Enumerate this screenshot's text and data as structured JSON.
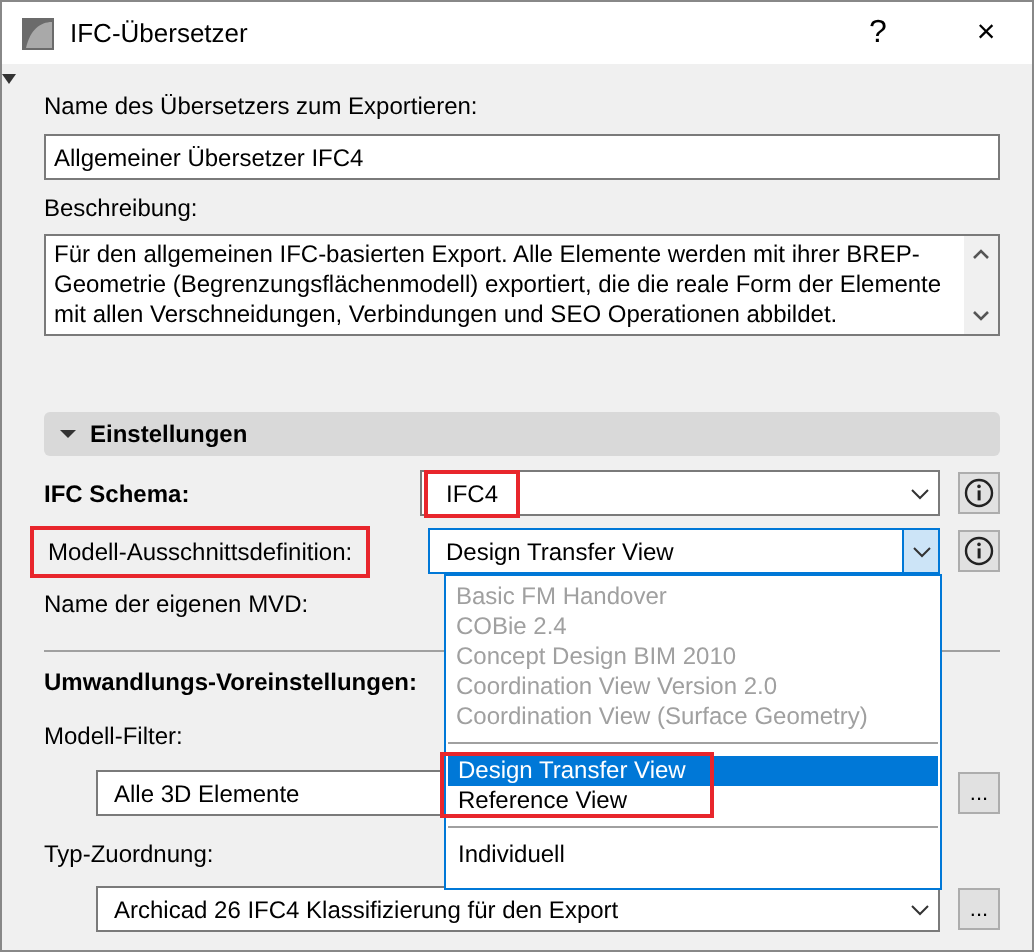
{
  "window": {
    "title": "IFC-Übersetzer",
    "help": "?",
    "close": "×"
  },
  "name_field": {
    "label": "Name des Übersetzers zum Exportieren:",
    "value": "Allgemeiner Übersetzer IFC4"
  },
  "description": {
    "label": "Beschreibung:",
    "value": "Für den allgemeinen IFC-basierten Export. Alle Elemente werden mit ihrer BREP-Geometrie (Begrenzungsflächenmodell) exportiert, die die reale Form der Elemente mit allen Verschneidungen, Verbindungen und SEO Operationen abbildet."
  },
  "section": {
    "title": "Einstellungen",
    "expanded": true
  },
  "ifc_schema": {
    "label": "IFC Schema:",
    "value": "IFC4",
    "highlighted": true
  },
  "mvd": {
    "label": "Modell-Ausschnittsdefinition:",
    "value": "Design Transfer View",
    "label_highlighted": true,
    "expanded": true
  },
  "mvd_options": [
    {
      "highlighted": false,
      "options": [
        {
          "label": "Basic FM Handover",
          "disabled": true,
          "selected": false
        },
        {
          "label": "COBie 2.4",
          "disabled": true,
          "selected": false
        },
        {
          "label": "Concept Design BIM 2010",
          "disabled": true,
          "selected": false
        },
        {
          "label": "Coordination View Version 2.0",
          "disabled": true,
          "selected": false
        },
        {
          "label": "Coordination View (Surface Geometry)",
          "disabled": true,
          "selected": false
        }
      ]
    },
    {
      "highlighted": true,
      "options": [
        {
          "label": "Design Transfer View",
          "disabled": false,
          "selected": true
        },
        {
          "label": "Reference View",
          "disabled": false,
          "selected": false
        }
      ]
    },
    {
      "highlighted": false,
      "options": [
        {
          "label": "Individuell",
          "disabled": false,
          "selected": false
        }
      ]
    }
  ],
  "custom_mvd": {
    "label": "Name der eigenen MVD:"
  },
  "presets": {
    "title": "Umwandlungs-Voreinstellungen:"
  },
  "model_filter": {
    "label": "Modell-Filter:",
    "value": "Alle 3D Elemente",
    "button": "..."
  },
  "type_mapping": {
    "label": "Typ-Zuordnung:",
    "value": "Archicad 26 IFC4 Klassifizierung für den Export",
    "button": "..."
  }
}
